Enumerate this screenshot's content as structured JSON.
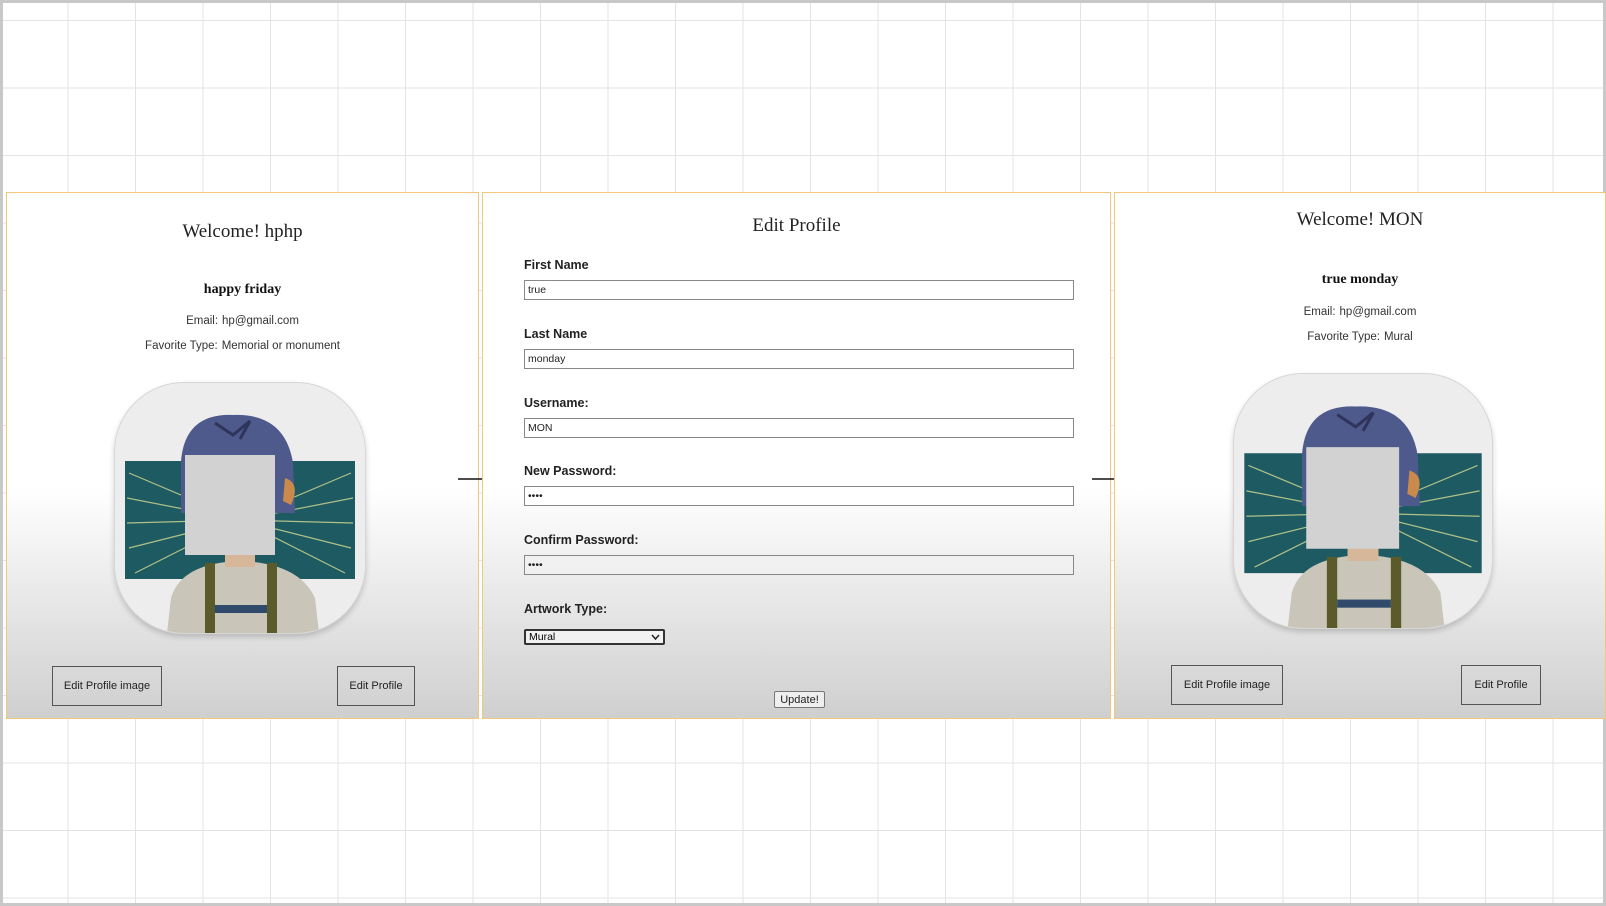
{
  "profile_before": {
    "welcome": "Welcome! hphp",
    "full_name": "happy friday",
    "email_label": "Email:",
    "email": "hp@gmail.com",
    "favorite_label": "Favorite Type:",
    "favorite": "Memorial or monument",
    "edit_image_button": "Edit Profile image",
    "edit_profile_button": "Edit Profile"
  },
  "edit_form": {
    "title": "Edit Profile",
    "first_name_label": "First Name",
    "first_name_value": "true",
    "last_name_label": "Last Name",
    "last_name_value": "monday",
    "username_label": "Username:",
    "username_value": "MON",
    "new_password_label": "New Password:",
    "new_password_value": "••••",
    "confirm_password_label": "Confirm Password:",
    "confirm_password_value": "••••",
    "artwork_type_label": "Artwork Type:",
    "artwork_type_selected": "Mural",
    "update_button": "Update!"
  },
  "profile_after": {
    "welcome": "Welcome! MON",
    "full_name": "true monday",
    "email_label": "Email:",
    "email": "hp@gmail.com",
    "favorite_label": "Favorite Type:",
    "favorite": "Mural",
    "edit_image_button": "Edit Profile image",
    "edit_profile_button": "Edit Profile"
  },
  "icons": {
    "flow_arrow": "right-arrow-icon",
    "select_caret": "chevron-down-icon"
  },
  "colors": {
    "panel_border": "#f3c77a",
    "avatar_background": "#1e5a62",
    "hair": "#4e5a8c"
  }
}
